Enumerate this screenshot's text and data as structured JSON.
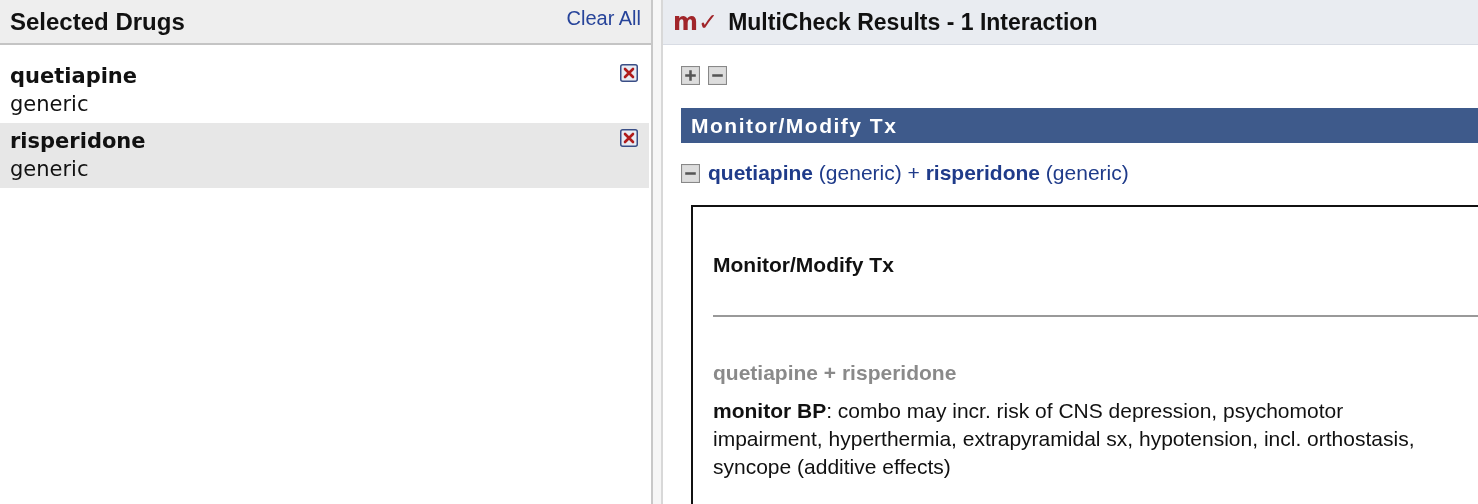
{
  "selected_drugs": {
    "title": "Selected Drugs",
    "clear_all": "Clear All",
    "drugs": [
      {
        "name": "quetiapine",
        "type": "generic",
        "selected": false
      },
      {
        "name": "risperidone",
        "type": "generic",
        "selected": true
      }
    ]
  },
  "results": {
    "title": "MultiCheck Results - 1 Interaction",
    "logo": "m✓",
    "sections": [
      {
        "heading": "Monitor/Modify Tx",
        "interactions": [
          {
            "pair": "**quetiapine** (generic) + **risperidone** (generic)",
            "expanded": true,
            "detail": {
              "title": "Monitor/Modify Tx",
              "subtitle": "quetiapine + risperidone",
              "description": "**monitor BP**: combo may incr. risk of CNS depression, psychomotor impairment, hyperthermia, extrapyramidal sx, hypotension, incl. orthostasis, syncope (additive effects)"
            }
          }
        ]
      }
    ]
  }
}
